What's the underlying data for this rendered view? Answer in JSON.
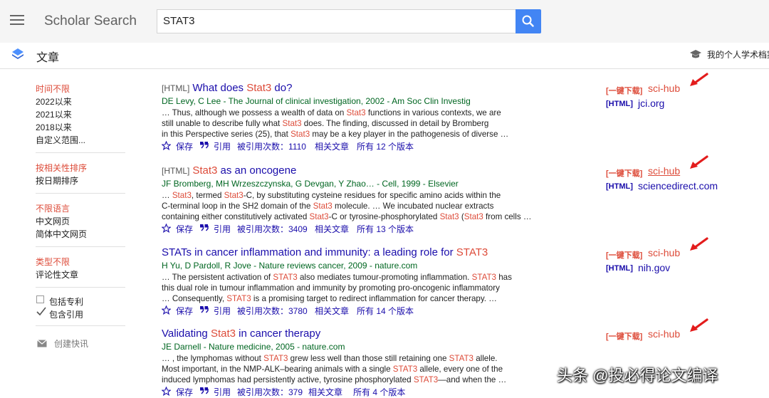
{
  "header": {
    "brand": "Scholar Search",
    "query": "STAT3"
  },
  "subbar": {
    "section_label": "文章",
    "profile_label": "我的个人学术档案"
  },
  "sidebar": {
    "time": [
      "时间不限",
      "2022以来",
      "2021以来",
      "2018以来",
      "自定义范围..."
    ],
    "sort": [
      "按相关性排序",
      "按日期排序"
    ],
    "lang": [
      "不限语言",
      "中文网页",
      "简体中文网页"
    ],
    "type": [
      "类型不限",
      "评论性文章"
    ],
    "include_patents": "包括专利",
    "include_citations": "包含引用",
    "create_alert": "创建快讯"
  },
  "results": [
    {
      "tag": "[HTML]",
      "title_pre": "What does ",
      "title_hl": "Stat3",
      "title_post": " do?",
      "authors": "DE Levy, C Lee - The Journal of clinical investigation, 2002 - Am Soc Clin Investig",
      "snippet1": "… Thus, although we possess a wealth of data on Stat3 functions in various contexts, we are",
      "snippet2": "still unable to describe fully what Stat3 does. The finding, discussed in detail by Bromberg",
      "snippet3": "in this Perspective series (25), that Stat3 may be a key player in the pathogenesis of diverse …",
      "save": "保存",
      "cite": "引用",
      "cited_by": "被引用次数：1110",
      "related": "相关文章",
      "versions": "所有 12 个版本",
      "dl_prefix": "[一键下载]",
      "dl_link": "sci-hub",
      "html_tag": "[HTML]",
      "html_link": "jci.org"
    },
    {
      "tag": "[HTML]",
      "title_pre": "",
      "title_hl": "Stat3",
      "title_post": " as an oncogene",
      "authors": "JF Bromberg, MH Wrzeszczynska, G Devgan, Y Zhao… - Cell, 1999 - Elsevier",
      "snippet1": "… Stat3, termed Stat3-C, by substituting cysteine residues for specific amino acids within the",
      "snippet2": "C-terminal loop in the SH2 domain of the Stat3 molecule. … We incubated nuclear extracts",
      "snippet3": "containing either constitutively activated Stat3-C or tyrosine-phosphorylated Stat3 (Stat3 from cells …",
      "save": "保存",
      "cite": "引用",
      "cited_by": "被引用次数：3409",
      "related": "相关文章",
      "versions": "所有 13 个版本",
      "dl_prefix": "[一键下载]",
      "dl_link": "sci-hub",
      "html_tag": "[HTML]",
      "html_link": "sciencedirect.com"
    },
    {
      "tag": "",
      "title_pre": "STATs in cancer inflammation and immunity: a leading role for ",
      "title_hl": "STAT3",
      "title_post": "",
      "authors": "H Yu, D Pardoll, R Jove - Nature reviews cancer, 2009 - nature.com",
      "snippet1": "… The persistent activation of STAT3 also mediates tumour-promoting inflammation. STAT3 has",
      "snippet2": "this dual role in tumour inflammation and immunity by promoting pro-oncogenic inflammatory",
      "snippet3": "… Consequently, STAT3 is a promising target to redirect inflammation for cancer therapy. …",
      "save": "保存",
      "cite": "引用",
      "cited_by": "被引用次数：3780",
      "related": "相关文章",
      "versions": "所有 14 个版本",
      "dl_prefix": "[一键下载]",
      "dl_link": "sci-hub",
      "html_tag": "[HTML]",
      "html_link": "nih.gov"
    },
    {
      "tag": "",
      "title_pre": "Validating ",
      "title_hl": "Stat3",
      "title_post": " in cancer therapy",
      "authors": "JE Darnell - Nature medicine, 2005 - nature.com",
      "snippet1": "… , the lymphomas without STAT3 grew less well than those still retaining one STAT3 allele.",
      "snippet2": "Most important, in the NMP-ALK–bearing animals with a single STAT3 allele, every one of the",
      "snippet3": "induced lymphomas had persistently active, tyrosine phosphorylated STAT3—and when the …",
      "save": "保存",
      "cite": "引用",
      "cited_by": "被引用次数：379",
      "related": "相关文章",
      "versions": "所有 4 个版本",
      "dl_prefix": "[一键下载]",
      "dl_link": "sci-hub",
      "html_tag": "",
      "html_link": ""
    }
  ],
  "highlight_terms": [
    "Stat3",
    "STAT3"
  ],
  "watermark": "头条 @投必得论文编译",
  "colors": {
    "link_blue": "#1a0dab",
    "highlight_red": "#dd4b39",
    "author_green": "#006621",
    "search_button": "#4285f4",
    "arrow_red": "#e31c1c"
  },
  "icons": {
    "menu": "hamburger-icon",
    "search": "magnifier-icon",
    "articles": "stacked-diamond-icon",
    "profile": "graduation-cap-icon",
    "save": "star-icon",
    "cite": "quote-icon",
    "alert": "envelope-icon",
    "checkbox_checked": "checkmark-icon"
  }
}
